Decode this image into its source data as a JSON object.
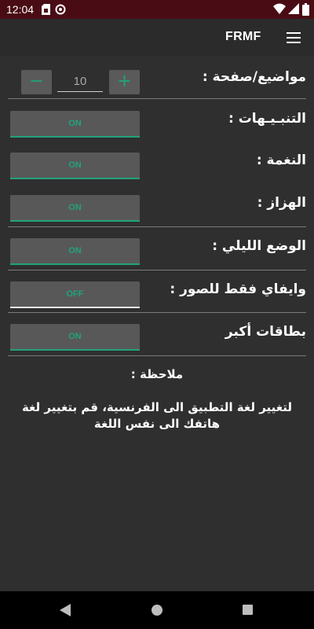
{
  "status_bar": {
    "time": "12:04"
  },
  "app_bar": {
    "title": "FRMF"
  },
  "topics_per_page": {
    "label": "مواضيع/صفحة :",
    "value": "10",
    "minus_symbol": "−",
    "plus_symbol": "+"
  },
  "settings": {
    "notifications": {
      "label": "التنبـيـهات :",
      "state": "ON"
    },
    "ringtone": {
      "label": "النغمة :",
      "state": "ON"
    },
    "vibration": {
      "label": "الهزاز :",
      "state": "ON"
    },
    "night_mode": {
      "label": "الوضع الليلي :",
      "state": "ON"
    },
    "wifi_images": {
      "label": "وايفاي فقط للصور :",
      "state": "OFF"
    },
    "bigger_cards": {
      "label": "بطاقات أكبر",
      "state": "ON"
    }
  },
  "note": {
    "title": "ملاحظة :",
    "text": "لتغيير لغة التطبيق الى الفرنسية، قم بتغيير لغة هاتفك الى نفس اللغة"
  },
  "colors": {
    "accent": "#21a37c",
    "status_bar_bg": "#4a0c14",
    "background": "#2f2f2f",
    "toggle_bg": "#585858"
  },
  "icons": {
    "status_bar": [
      "sim-card-icon",
      "data-saver-icon",
      "wifi-icon",
      "signal-icon",
      "battery-icon"
    ],
    "app_bar": [
      "menu-icon"
    ],
    "nav_bar": [
      "back-icon",
      "home-icon",
      "recents-icon"
    ]
  }
}
